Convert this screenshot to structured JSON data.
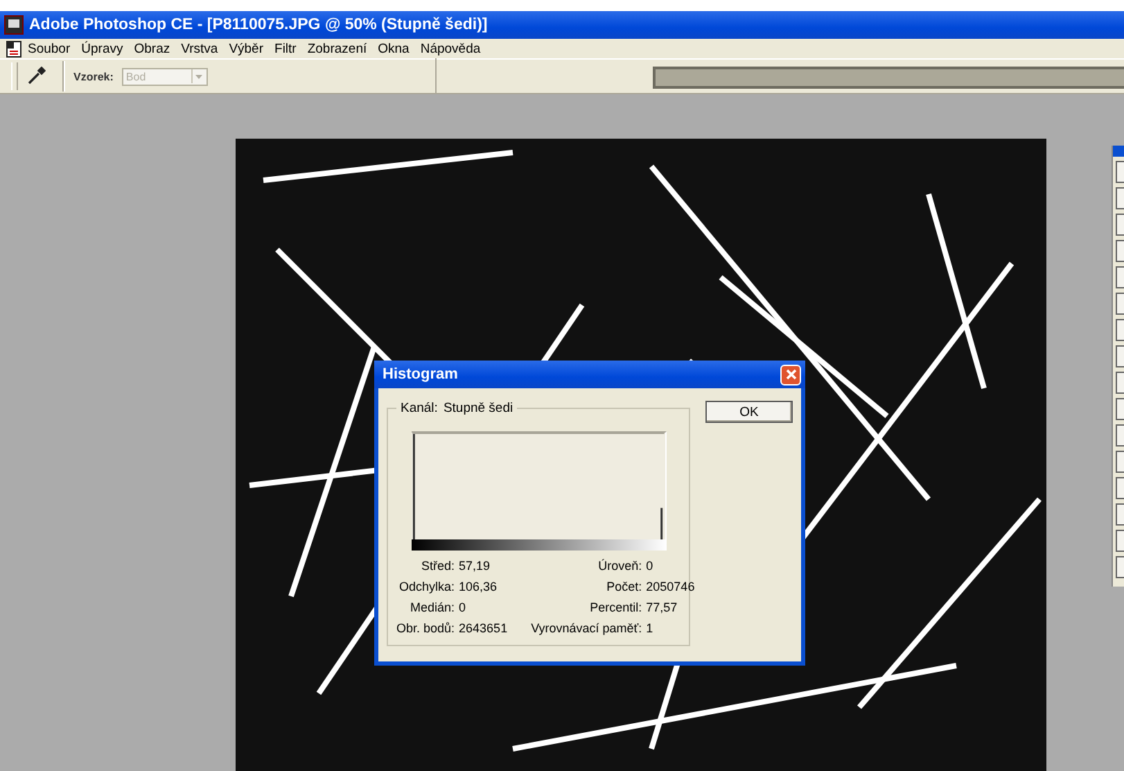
{
  "window": {
    "title": "Adobe Photoshop CE - [P8110075.JPG @ 50% (Stupně šedi)]"
  },
  "menu": [
    "Soubor",
    "Úpravy",
    "Obraz",
    "Vrstva",
    "Výběr",
    "Filtr",
    "Zobrazení",
    "Okna",
    "Nápověda"
  ],
  "toolbar": {
    "sample_label": "Vzorek:",
    "sample_value": "Bod",
    "sample_disabled": true
  },
  "dialog": {
    "title": "Histogram",
    "channel_label": "Kanál:",
    "channel_value": "Stupně šedi",
    "ok": "OK",
    "stats_left": [
      {
        "label": "Střed:",
        "value": "57,19"
      },
      {
        "label": "Odchylka:",
        "value": "106,36"
      },
      {
        "label": "Medián:",
        "value": "0"
      },
      {
        "label": "Obr. bodů:",
        "value": "2643651"
      }
    ],
    "stats_right": [
      {
        "label": "Úroveň:",
        "value": "0"
      },
      {
        "label": "Počet:",
        "value": "2050746"
      },
      {
        "label": "Percentil:",
        "value": "77,57"
      },
      {
        "label": "Vyrovnávací paměť:",
        "value": "1"
      }
    ]
  }
}
